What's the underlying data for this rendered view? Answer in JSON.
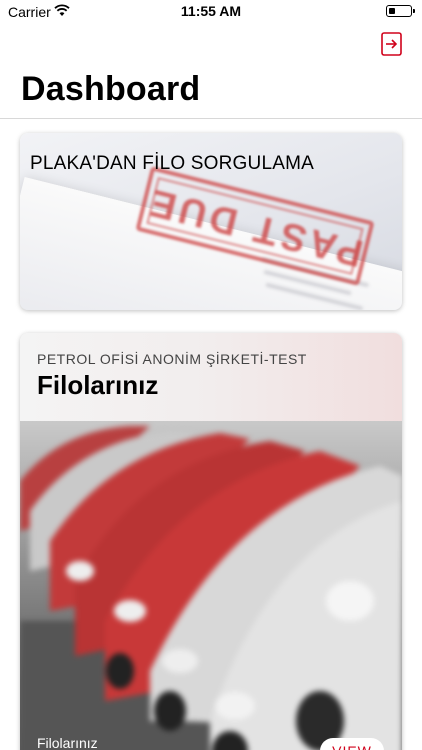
{
  "status_bar": {
    "carrier": "Carrier",
    "time": "11:55 AM"
  },
  "header": {
    "title": "Dashboard",
    "logout_icon": "logout-icon",
    "accent_color": "#d0021b"
  },
  "cards": {
    "plate_query": {
      "title": "PLAKA'DAN FİLO SORGULAMA",
      "stamp_text": "PAST DUE"
    },
    "fleets": {
      "company": "PETROL OFİSİ ANONİM ŞİRKETİ-TEST",
      "title": "Filolarınız",
      "caption": "Filolarınız",
      "button_label": "VIEW"
    }
  }
}
